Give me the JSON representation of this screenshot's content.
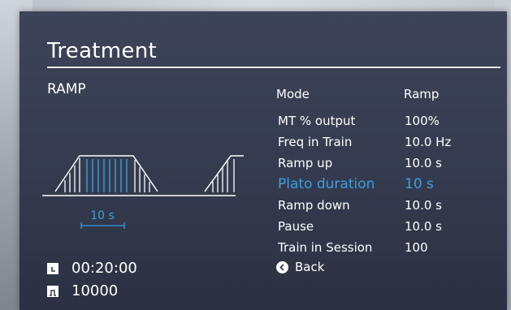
{
  "screen": {
    "title": "Treatment",
    "subtitle": "RAMP"
  },
  "diagram": {
    "plato_label": "10 s",
    "accent_color": "#3d9ee0"
  },
  "status": {
    "time": "00:20:00",
    "time_icon": "clock-icon",
    "pulses": "10000",
    "pulses_icon": "pulse-icon"
  },
  "mode": {
    "label": "Mode",
    "value": "Ramp"
  },
  "params": [
    {
      "label": "MT % output",
      "value": "100%"
    },
    {
      "label": "Freq in Train",
      "value": "10.0 Hz"
    },
    {
      "label": "Ramp up",
      "value": "10.0 s"
    },
    {
      "label": "Plato duration",
      "value": "10 s",
      "active": true
    },
    {
      "label": "Ramp down",
      "value": "10.0 s"
    },
    {
      "label": "Pause",
      "value": "10.0 s"
    },
    {
      "label": "Train in Session",
      "value": "100"
    }
  ],
  "back": {
    "label": "Back",
    "icon": "chevron-left-icon"
  }
}
